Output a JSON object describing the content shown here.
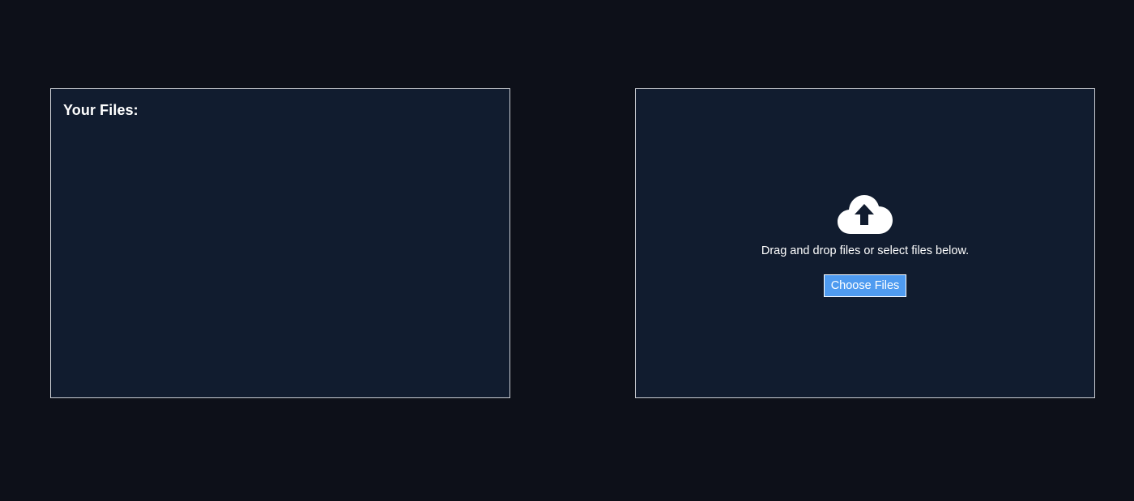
{
  "files_panel": {
    "title": "Your Files:"
  },
  "upload_panel": {
    "icon": "cloud-upload-icon",
    "instruction": "Drag and drop files or select files below.",
    "choose_button_label": "Choose Files"
  },
  "colors": {
    "background": "#0d1019",
    "panel": "#111c2f",
    "panel_border": "#c9ccd2",
    "button": "#4f9bf0",
    "text": "#ffffff"
  }
}
